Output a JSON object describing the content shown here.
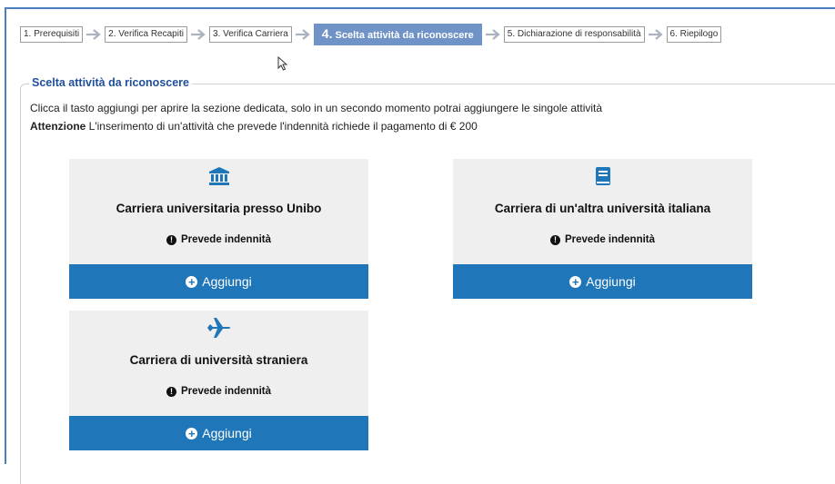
{
  "wizard": {
    "steps": [
      {
        "label": "1. Prerequisiti"
      },
      {
        "label": "2. Verifica Recapiti"
      },
      {
        "label": "3. Verifica Carriera"
      },
      {
        "number": "4.",
        "label": "Scelta attività da riconoscere"
      },
      {
        "label": "5. Dichiarazione di responsabilità"
      },
      {
        "label": "6. Riepilogo"
      }
    ],
    "active_step": 4
  },
  "section": {
    "legend": "Scelta attività da riconoscere",
    "intro": "Clicca il tasto aggiungi per aprire la sezione dedicata, solo in un secondo momento potrai aggiungere le singole attività",
    "warning_label": "Attenzione",
    "warning_text": " L'inserimento di un'attività che prevede l'indennità richiede il pagamento di € 200"
  },
  "cards": [
    {
      "icon": "university-icon",
      "title": "Carriera universitaria presso Unibo",
      "note": "Prevede indennità",
      "button": "Aggiungi"
    },
    {
      "icon": "book-icon",
      "title": "Carriera di un'altra università italiana",
      "note": "Prevede indennità",
      "button": "Aggiungi"
    },
    {
      "icon": "plane-icon",
      "title": "Carriera di università straniera",
      "note": "Prevede indennità",
      "button": "Aggiungi"
    }
  ],
  "colors": {
    "accent": "#1f76b8",
    "active_step": "#6f93c6",
    "legend": "#1e4f9c",
    "card_bg": "#efefef"
  }
}
